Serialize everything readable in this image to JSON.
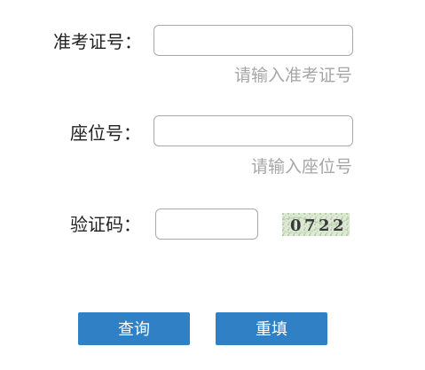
{
  "form": {
    "exam_number": {
      "label": "准考证号：",
      "value": "",
      "hint": "请输入准考证号"
    },
    "seat_number": {
      "label": "座位号：",
      "value": "",
      "hint": "请输入座位号"
    },
    "captcha": {
      "label": "验证码：",
      "value": "",
      "image_text": "0722",
      "digits": [
        "0",
        "7",
        "2",
        "2"
      ]
    }
  },
  "buttons": {
    "query_label": "查询",
    "reset_label": "重填"
  },
  "colors": {
    "button": "#2f80c5",
    "hint": "#a6a6a6",
    "border": "#aaaaaa"
  }
}
